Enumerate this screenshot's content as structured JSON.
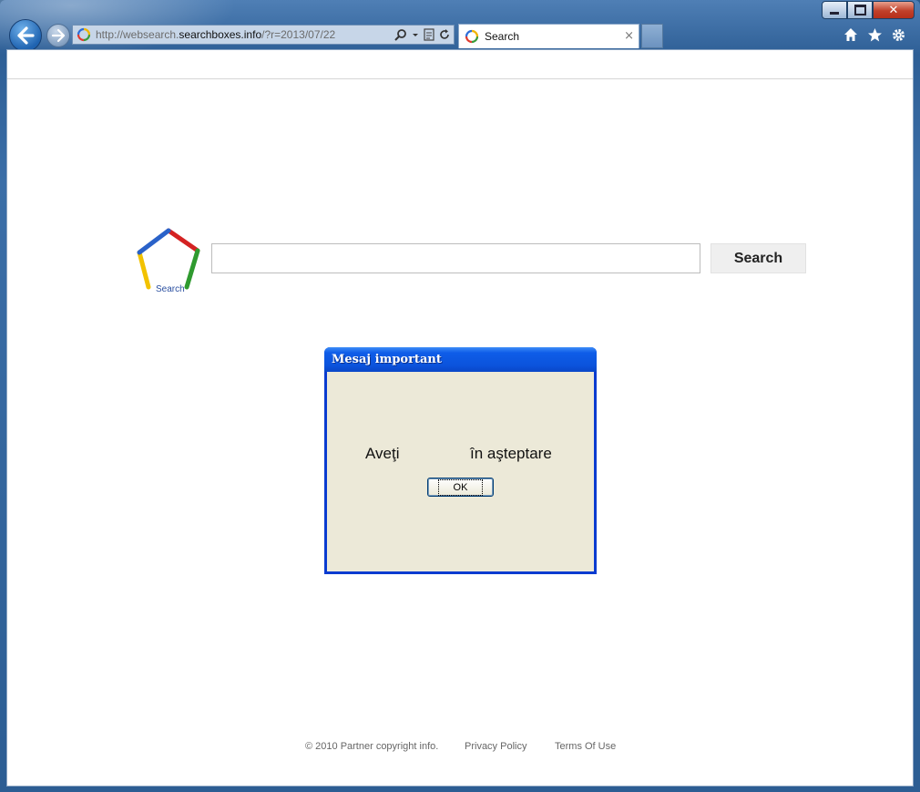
{
  "browser": {
    "url_prefix": "http://websearch.",
    "url_domain": "searchboxes.info",
    "url_suffix": "/?r=2013/07/22",
    "tab_label": "Search",
    "tab_close": "×",
    "close_glyph": "✕"
  },
  "page": {
    "logo_label": "Search",
    "search_button": "Search",
    "search_value": ""
  },
  "dialog": {
    "title": "Mesaj important",
    "message_part1": "Aveţi",
    "message_part2": "în aşteptare",
    "ok_label": "OK"
  },
  "footer": {
    "copyright": "© 2010 Partner copyright info.",
    "privacy": "Privacy Policy",
    "terms": "Terms Of Use"
  },
  "colors": {
    "dialog_titlebar": "#0b53dc",
    "dialog_body": "#ece9d8",
    "frame": "#2e5f96"
  }
}
